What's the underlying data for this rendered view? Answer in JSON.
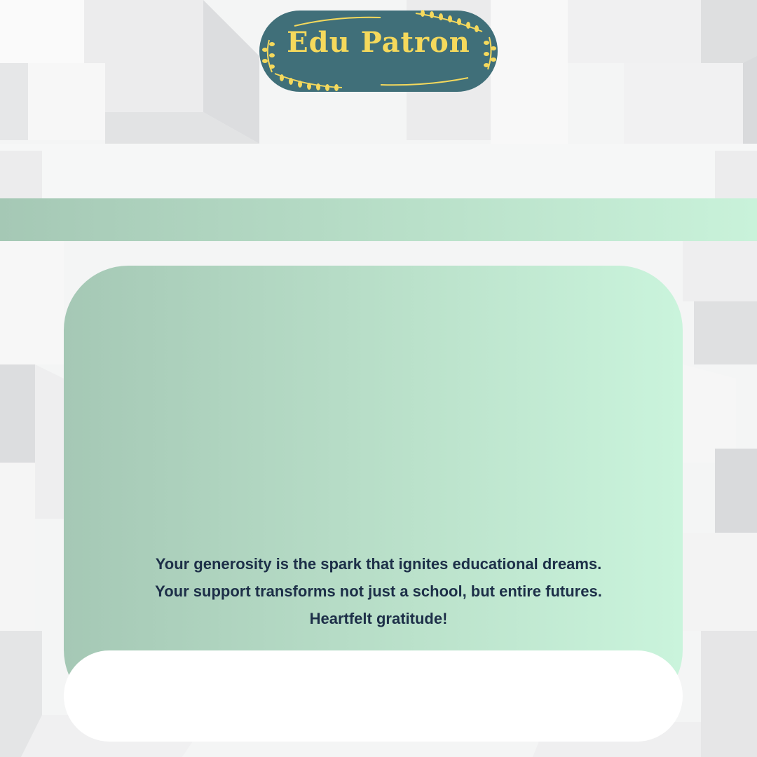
{
  "logo": {
    "text": "Edu Patron",
    "badge_color": "#406f79",
    "text_color": "#f5d95c",
    "decoration": "laurel-vine-icon"
  },
  "message": {
    "text": "Your generosity is the spark that ignites educational dreams. Your support transforms not just a school, but entire futures. Heartfelt gratitude!"
  },
  "colors": {
    "gradient_start": "#a5c8b5",
    "gradient_end": "#c9f2da",
    "text": "#1d2f48",
    "background": "#f3f4f4"
  }
}
